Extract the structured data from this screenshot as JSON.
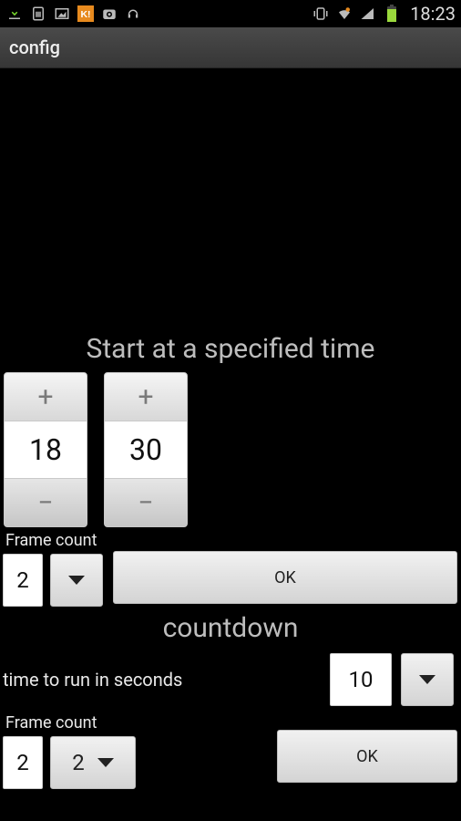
{
  "status_bar": {
    "time": "18:23"
  },
  "action_bar": {
    "title": "config"
  },
  "specified_time": {
    "title": "Start at a specified time",
    "hours": "18",
    "minutes": "30",
    "frame_label": "Frame count",
    "frame_value": "2",
    "ok_label": "OK"
  },
  "countdown": {
    "title": "countdown",
    "time_label": "time to run in seconds",
    "time_value": "10",
    "frame_label": "Frame count",
    "frame_value": "2",
    "frame_dropdown": "2",
    "ok_label": "OK"
  }
}
